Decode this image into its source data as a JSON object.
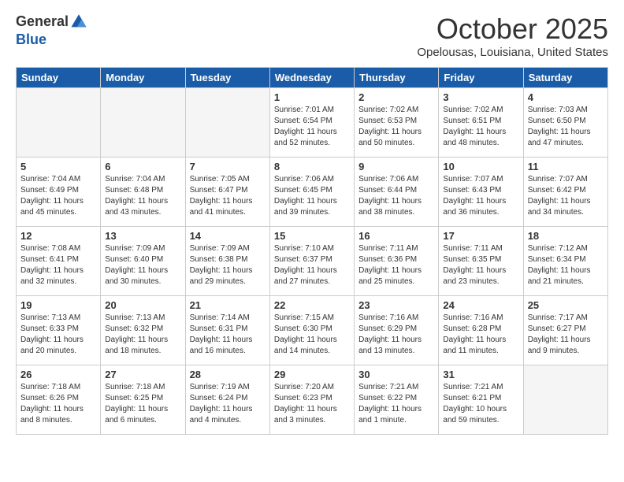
{
  "header": {
    "logo_line1": "General",
    "logo_line2": "Blue",
    "month": "October 2025",
    "location": "Opelousas, Louisiana, United States"
  },
  "weekdays": [
    "Sunday",
    "Monday",
    "Tuesday",
    "Wednesday",
    "Thursday",
    "Friday",
    "Saturday"
  ],
  "weeks": [
    [
      {
        "day": "",
        "text": ""
      },
      {
        "day": "",
        "text": ""
      },
      {
        "day": "",
        "text": ""
      },
      {
        "day": "1",
        "text": "Sunrise: 7:01 AM\nSunset: 6:54 PM\nDaylight: 11 hours and 52 minutes."
      },
      {
        "day": "2",
        "text": "Sunrise: 7:02 AM\nSunset: 6:53 PM\nDaylight: 11 hours and 50 minutes."
      },
      {
        "day": "3",
        "text": "Sunrise: 7:02 AM\nSunset: 6:51 PM\nDaylight: 11 hours and 48 minutes."
      },
      {
        "day": "4",
        "text": "Sunrise: 7:03 AM\nSunset: 6:50 PM\nDaylight: 11 hours and 47 minutes."
      }
    ],
    [
      {
        "day": "5",
        "text": "Sunrise: 7:04 AM\nSunset: 6:49 PM\nDaylight: 11 hours and 45 minutes."
      },
      {
        "day": "6",
        "text": "Sunrise: 7:04 AM\nSunset: 6:48 PM\nDaylight: 11 hours and 43 minutes."
      },
      {
        "day": "7",
        "text": "Sunrise: 7:05 AM\nSunset: 6:47 PM\nDaylight: 11 hours and 41 minutes."
      },
      {
        "day": "8",
        "text": "Sunrise: 7:06 AM\nSunset: 6:45 PM\nDaylight: 11 hours and 39 minutes."
      },
      {
        "day": "9",
        "text": "Sunrise: 7:06 AM\nSunset: 6:44 PM\nDaylight: 11 hours and 38 minutes."
      },
      {
        "day": "10",
        "text": "Sunrise: 7:07 AM\nSunset: 6:43 PM\nDaylight: 11 hours and 36 minutes."
      },
      {
        "day": "11",
        "text": "Sunrise: 7:07 AM\nSunset: 6:42 PM\nDaylight: 11 hours and 34 minutes."
      }
    ],
    [
      {
        "day": "12",
        "text": "Sunrise: 7:08 AM\nSunset: 6:41 PM\nDaylight: 11 hours and 32 minutes."
      },
      {
        "day": "13",
        "text": "Sunrise: 7:09 AM\nSunset: 6:40 PM\nDaylight: 11 hours and 30 minutes."
      },
      {
        "day": "14",
        "text": "Sunrise: 7:09 AM\nSunset: 6:38 PM\nDaylight: 11 hours and 29 minutes."
      },
      {
        "day": "15",
        "text": "Sunrise: 7:10 AM\nSunset: 6:37 PM\nDaylight: 11 hours and 27 minutes."
      },
      {
        "day": "16",
        "text": "Sunrise: 7:11 AM\nSunset: 6:36 PM\nDaylight: 11 hours and 25 minutes."
      },
      {
        "day": "17",
        "text": "Sunrise: 7:11 AM\nSunset: 6:35 PM\nDaylight: 11 hours and 23 minutes."
      },
      {
        "day": "18",
        "text": "Sunrise: 7:12 AM\nSunset: 6:34 PM\nDaylight: 11 hours and 21 minutes."
      }
    ],
    [
      {
        "day": "19",
        "text": "Sunrise: 7:13 AM\nSunset: 6:33 PM\nDaylight: 11 hours and 20 minutes."
      },
      {
        "day": "20",
        "text": "Sunrise: 7:13 AM\nSunset: 6:32 PM\nDaylight: 11 hours and 18 minutes."
      },
      {
        "day": "21",
        "text": "Sunrise: 7:14 AM\nSunset: 6:31 PM\nDaylight: 11 hours and 16 minutes."
      },
      {
        "day": "22",
        "text": "Sunrise: 7:15 AM\nSunset: 6:30 PM\nDaylight: 11 hours and 14 minutes."
      },
      {
        "day": "23",
        "text": "Sunrise: 7:16 AM\nSunset: 6:29 PM\nDaylight: 11 hours and 13 minutes."
      },
      {
        "day": "24",
        "text": "Sunrise: 7:16 AM\nSunset: 6:28 PM\nDaylight: 11 hours and 11 minutes."
      },
      {
        "day": "25",
        "text": "Sunrise: 7:17 AM\nSunset: 6:27 PM\nDaylight: 11 hours and 9 minutes."
      }
    ],
    [
      {
        "day": "26",
        "text": "Sunrise: 7:18 AM\nSunset: 6:26 PM\nDaylight: 11 hours and 8 minutes."
      },
      {
        "day": "27",
        "text": "Sunrise: 7:18 AM\nSunset: 6:25 PM\nDaylight: 11 hours and 6 minutes."
      },
      {
        "day": "28",
        "text": "Sunrise: 7:19 AM\nSunset: 6:24 PM\nDaylight: 11 hours and 4 minutes."
      },
      {
        "day": "29",
        "text": "Sunrise: 7:20 AM\nSunset: 6:23 PM\nDaylight: 11 hours and 3 minutes."
      },
      {
        "day": "30",
        "text": "Sunrise: 7:21 AM\nSunset: 6:22 PM\nDaylight: 11 hours and 1 minute."
      },
      {
        "day": "31",
        "text": "Sunrise: 7:21 AM\nSunset: 6:21 PM\nDaylight: 10 hours and 59 minutes."
      },
      {
        "day": "",
        "text": ""
      }
    ]
  ]
}
